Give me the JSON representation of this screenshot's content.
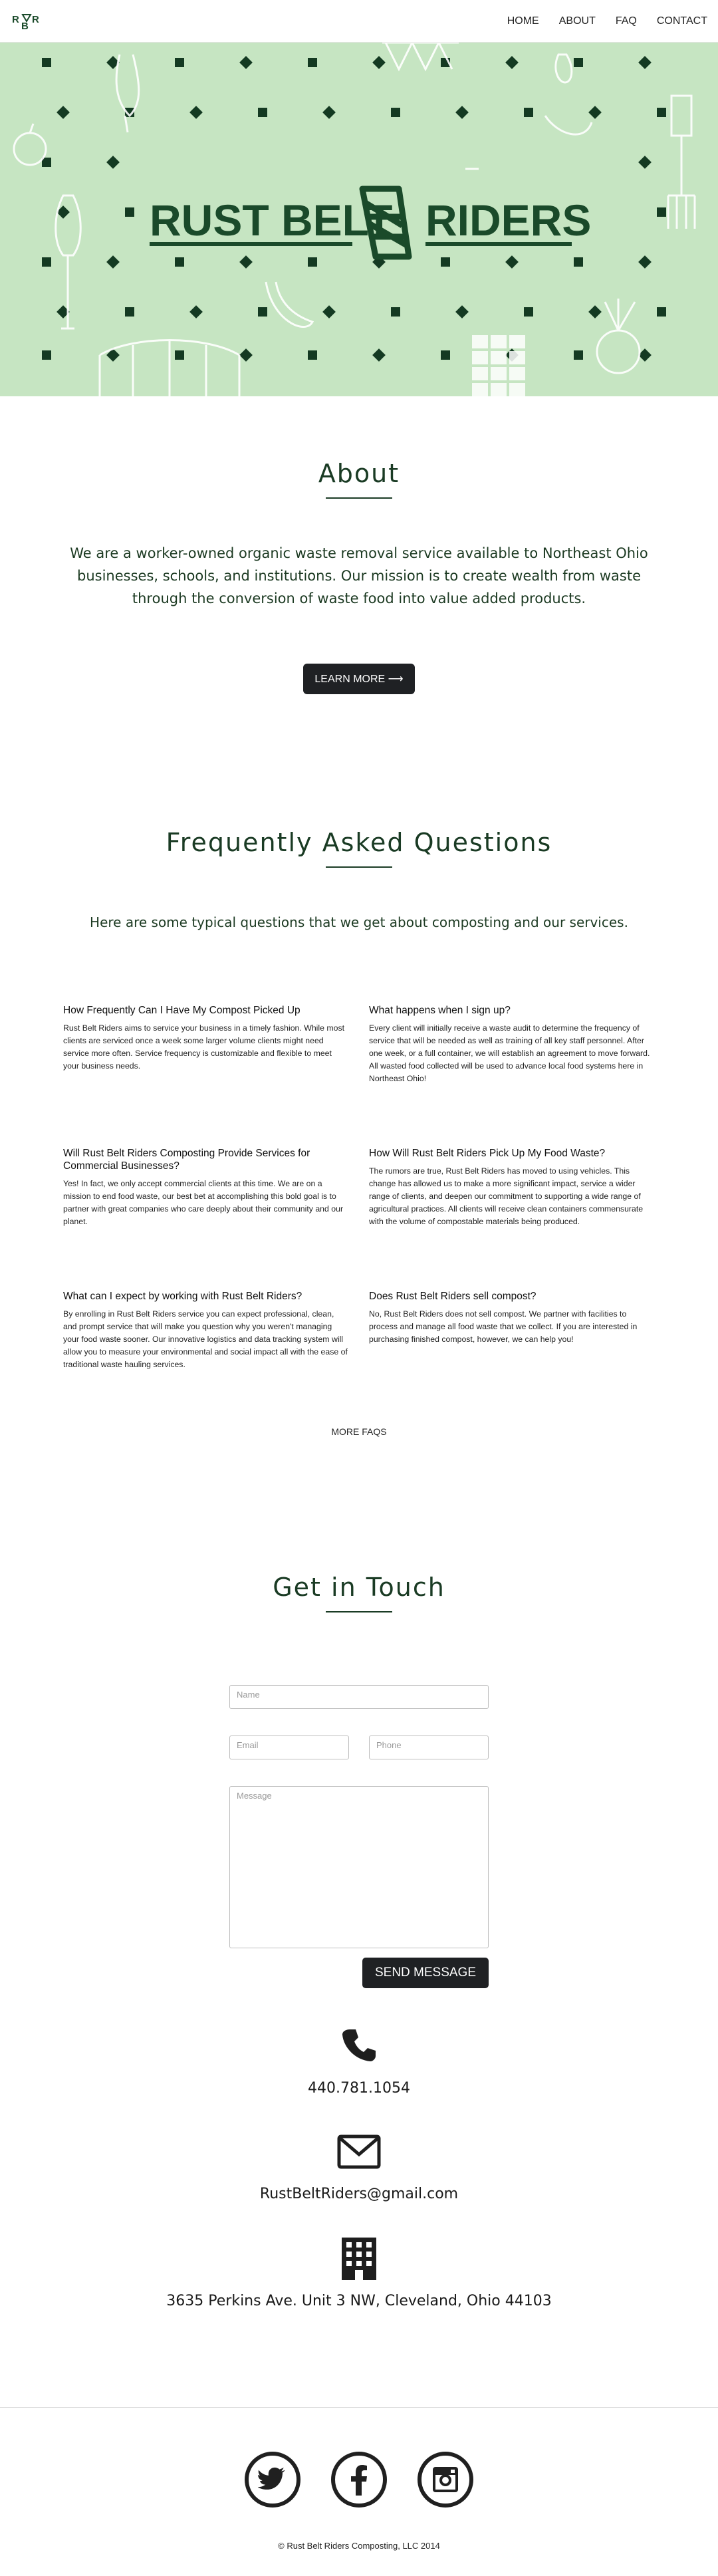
{
  "nav": {
    "logo_text": "RBR",
    "items": [
      {
        "label": "HOME"
      },
      {
        "label": "ABOUT"
      },
      {
        "label": "FAQ"
      },
      {
        "label": "CONTACT"
      }
    ]
  },
  "hero": {
    "brand_left": "RUST BELT",
    "brand_right": "RIDERS",
    "bg_color": "#c6e5c2",
    "brand_color": "#1a4a2a"
  },
  "about": {
    "title": "About",
    "body": "We are a worker-owned organic waste removal service available to Northeast Ohio businesses, schools, and institutions. Our mission is to create wealth from waste through the conversion of waste food into value added products.",
    "button": "LEARN MORE ⟶"
  },
  "faq": {
    "title": "Frequently Asked Questions",
    "intro": "Here are some typical questions that we get about composting and our services.",
    "items": [
      {
        "q": "How Frequently Can I Have My Compost Picked Up",
        "a": "Rust Belt Riders aims to service your business in a timely fashion. While most clients are serviced once a week some larger volume clients might need service more often. Service frequency is customizable and flexible to meet your business needs."
      },
      {
        "q": "What happens when I sign up?",
        "a": "Every client will initially receive a waste audit to determine the frequency of service that will be needed as well as training of all key staff personnel. After one week, or a full container, we will establish an agreement to move forward. All wasted food collected will be used to advance local food systems here in Northeast Ohio!"
      },
      {
        "q": "Will Rust Belt Riders Composting Provide Services for Commercial Businesses?",
        "a": "Yes! In fact, we only accept commercial clients at this time. We are on a mission to end food waste, our best bet at accomplishing this bold goal is to partner with great companies who care deeply about their community and our planet."
      },
      {
        "q": "How Will Rust Belt Riders Pick Up My Food Waste?",
        "a": "The rumors are true, Rust Belt Riders has moved to using vehicles. This change has allowed us to make a more significant impact, service a wider range of clients, and deepen our commitment to supporting a wide range of agricultural practices. All clients will receive clean containers commensurate with the volume of compostable materials being produced."
      },
      {
        "q": "What can I expect by working with Rust Belt Riders?",
        "a": "By enrolling in Rust Belt Riders service you can expect professional, clean, and prompt service that will make you question why you weren't managing your food waste sooner. Our innovative logistics and data tracking system will allow you to measure your environmental and social impact all with the ease of traditional waste hauling services."
      },
      {
        "q": "Does Rust Belt Riders sell compost?",
        "a": "No, Rust Belt Riders does not sell compost. We partner with facilities to process and manage all food waste that we collect. If you are interested in purchasing finished compost, however, we can help you!"
      }
    ],
    "more": "MORE FAQS"
  },
  "contact": {
    "title": "Get in Touch",
    "name_placeholder": "Name",
    "email_placeholder": "Email",
    "phone_placeholder": "Phone",
    "message_placeholder": "Message",
    "send": "SEND MESSAGE",
    "phone": "440.781.1054",
    "email": "RustBeltRiders@gmail.com",
    "address": "3635 Perkins Ave. Unit 3 NW, Cleveland, Ohio 44103"
  },
  "footer": {
    "copyright": "© Rust Belt Riders Composting, LLC 2014",
    "social": [
      "twitter-icon",
      "facebook-icon",
      "instagram-icon"
    ]
  }
}
